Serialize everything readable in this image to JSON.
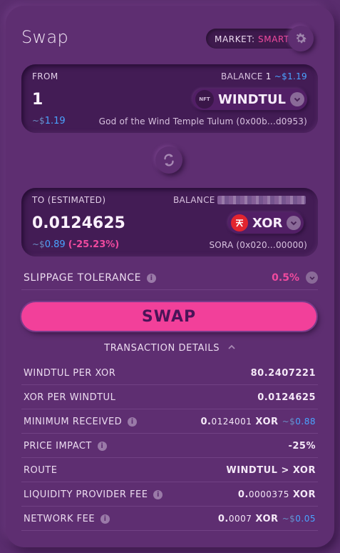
{
  "title": "Swap",
  "market": {
    "label": "MARKET:",
    "value": "SMART"
  },
  "from": {
    "label": "FROM",
    "balance_label": "BALANCE",
    "balance_value": "1",
    "balance_usd_prefix": "~$",
    "balance_usd": "1.19",
    "amount": "1",
    "usd_prefix": "~$",
    "usd": "1.19",
    "token": "WINDTUL",
    "token_badge": "NFT",
    "description": "God of the Wind Temple Tulum (0x00b...d0953)"
  },
  "to": {
    "label": "TO (ESTIMATED)",
    "balance_label": "BALANCE",
    "amount": "0.0124625",
    "usd_prefix": "~$",
    "usd": "0.89",
    "change": "(-25.23%)",
    "token": "XOR",
    "description": "SORA (0x020...00000)"
  },
  "slippage": {
    "label": "SLIPPAGE TOLERANCE",
    "value": "0.5%"
  },
  "swap_button": "SWAP",
  "transaction_details": "TRANSACTION DETAILS",
  "details": {
    "windtul_per_xor": {
      "label": "WINDTUL PER XOR",
      "value": "80.2407221"
    },
    "xor_per_windtul": {
      "label": "XOR PER WINDTUL",
      "value": "0.0124625"
    },
    "minimum_received": {
      "label": "MINIMUM RECEIVED",
      "lead": "0.",
      "rest": "0124001",
      "token": "XOR",
      "usd_prefix": "~$",
      "usd": "0.88"
    },
    "price_impact": {
      "label": "PRICE IMPACT",
      "value": "-25%"
    },
    "route": {
      "label": "ROUTE",
      "value": "WINDTUL > XOR"
    },
    "liquidity_fee": {
      "label": "LIQUIDITY PROVIDER FEE",
      "lead": "0.",
      "rest": "0000375",
      "token": "XOR"
    },
    "network_fee": {
      "label": "NETWORK FEE",
      "lead": "0.",
      "rest": "0007",
      "token": "XOR",
      "usd_prefix": "~$",
      "usd": "0.05"
    }
  },
  "colors": {
    "accent": "#f04a9e",
    "usd": "#4aa3ff",
    "background": "#5e2e71",
    "panel": "#431c55"
  }
}
